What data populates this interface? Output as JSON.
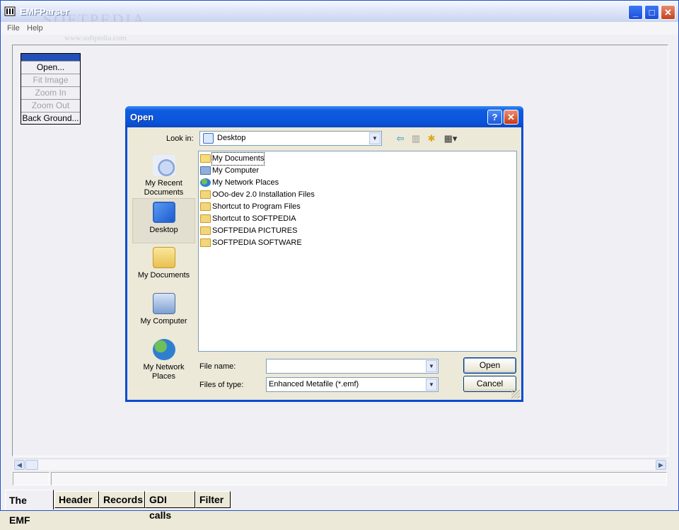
{
  "app": {
    "title": "EMFParser",
    "watermark": "SOFTPEDIA",
    "watermark_url": "www.softpedia.com",
    "window_buttons": {
      "minimize": "_",
      "maximize": "□",
      "close": "✕"
    }
  },
  "menu": {
    "items": [
      "File",
      "Help"
    ]
  },
  "side_panel": {
    "buttons": [
      {
        "label": "Open...",
        "enabled": true
      },
      {
        "label": "Fit Image",
        "enabled": false
      },
      {
        "label": "Zoom In",
        "enabled": false
      },
      {
        "label": "Zoom Out",
        "enabled": false
      },
      {
        "label": "Back Ground...",
        "enabled": true
      }
    ]
  },
  "scrollbar": {
    "left_arrow": "◀",
    "right_arrow": "▶"
  },
  "tabs": [
    "The EMF",
    "Header",
    "Records",
    "GDI calls",
    "Filter"
  ],
  "dialog": {
    "title": "Open",
    "help_button": "?",
    "close_button": "✕",
    "look_in_label": "Look in:",
    "look_in_value": "Desktop",
    "toolbar_icons": [
      "back-icon",
      "up-folder-icon",
      "new-folder-icon",
      "view-menu-icon"
    ],
    "places": [
      "My Recent Documents",
      "Desktop",
      "My Documents",
      "My Computer",
      "My Network Places"
    ],
    "selected_place": "Desktop",
    "files": [
      {
        "name": "My Documents",
        "icon": "my-documents-icon"
      },
      {
        "name": "My Computer",
        "icon": "my-computer-icon"
      },
      {
        "name": "My Network Places",
        "icon": "network-places-icon"
      },
      {
        "name": "OOo-dev 2.0 Installation Files",
        "icon": "folder-icon"
      },
      {
        "name": "Shortcut to Program Files",
        "icon": "folder-shortcut-icon"
      },
      {
        "name": "Shortcut to SOFTPEDIA",
        "icon": "folder-shortcut-icon"
      },
      {
        "name": "SOFTPEDIA PICTURES",
        "icon": "folder-shortcut-icon"
      },
      {
        "name": "SOFTPEDIA SOFTWARE",
        "icon": "folder-shortcut-icon"
      }
    ],
    "file_name_label": "File name:",
    "file_name_value": "",
    "files_of_type_label": "Files of type:",
    "files_of_type_value": "Enhanced Metafile (*.emf)",
    "open_button": "Open",
    "cancel_button": "Cancel"
  }
}
